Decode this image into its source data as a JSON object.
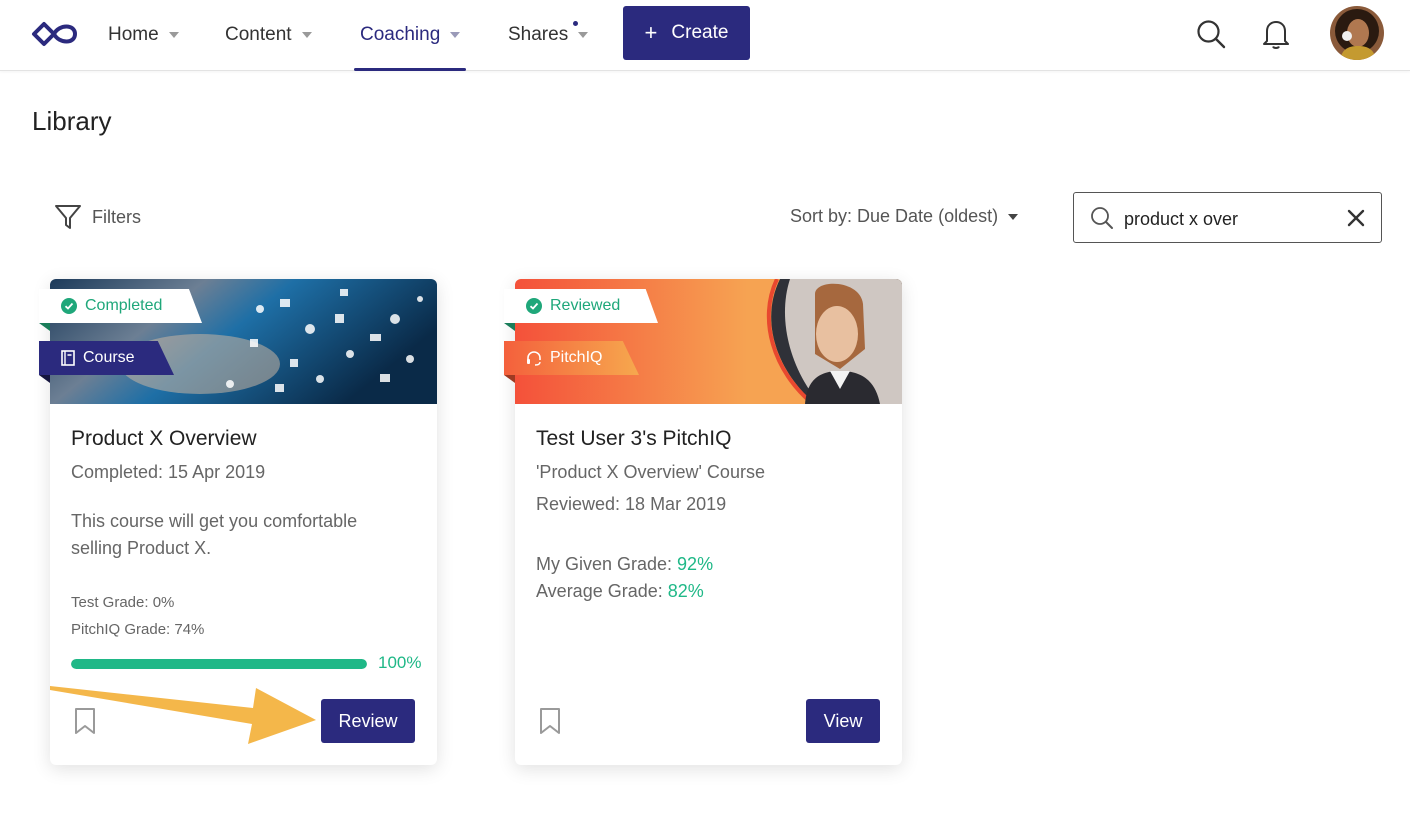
{
  "nav": {
    "items": [
      {
        "label": "Home"
      },
      {
        "label": "Content"
      },
      {
        "label": "Coaching",
        "active": true
      },
      {
        "label": "Shares",
        "has_dot": true
      }
    ],
    "create_label": "Create",
    "create_icon": "+"
  },
  "page": {
    "title": "Library",
    "filters_label": "Filters",
    "sort_label": "Sort by: Due Date (oldest)",
    "search_value": "product x over"
  },
  "cards": [
    {
      "status": "Completed",
      "type": "Course",
      "type_color": "#2b2a7e",
      "title": "Product X Overview",
      "meta": "Completed: 15 Apr 2019",
      "description": "This course will get you comfortable selling Product X.",
      "test_grade": "Test Grade: 0%",
      "pitchiq_grade": "PitchIQ Grade: 74%",
      "progress": 100,
      "progress_label": "100%",
      "button_label": "Review"
    },
    {
      "status": "Reviewed",
      "type": "PitchIQ",
      "type_color": "#f58a3c",
      "title": "Test User 3's PitchIQ",
      "meta": "'Product X Overview' Course",
      "meta2": "Reviewed: 18 Mar 2019",
      "given_grade_label": "My Given Grade: ",
      "given_grade_value": "92%",
      "average_grade_label": "Average Grade: ",
      "average_grade_value": "82%",
      "button_label": "View"
    }
  ],
  "colors": {
    "primary": "#2b2a7e",
    "success": "#1fb887",
    "annotation_arrow": "#f4b74a"
  },
  "icons": [
    "logo-icon",
    "search-icon",
    "bell-icon",
    "filter-icon",
    "close-icon",
    "check-circle-icon",
    "book-icon",
    "headset-icon",
    "bookmark-icon"
  ]
}
